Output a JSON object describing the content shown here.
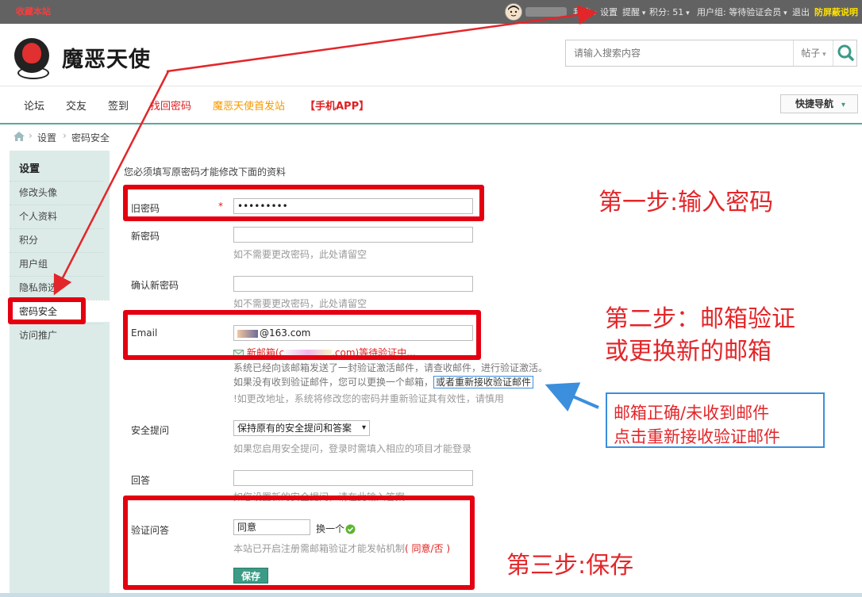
{
  "topbar": {
    "favorite": "收藏本站",
    "my": "我的",
    "settings": "设置",
    "remind": "提醒",
    "points": "积分: 51",
    "usergroup": "用户组: 等待验证会员",
    "logout": "退出",
    "anti_screen": "防屏蔽说明"
  },
  "header": {
    "logo_text": "魔恶天使",
    "search_placeholder": "请输入搜索内容",
    "search_type": "帖子"
  },
  "nav": {
    "items": [
      "论坛",
      "交友",
      "签到",
      "找回密码",
      "魔恶天使首发站",
      "【手机APP】"
    ],
    "quick_nav": "快捷导航"
  },
  "breadcrumb": {
    "items": [
      "设置",
      "密码安全"
    ]
  },
  "sidebar": {
    "title": "设置",
    "items": [
      "修改头像",
      "个人资料",
      "积分",
      "用户组",
      "隐私筛选",
      "密码安全",
      "访问推广"
    ],
    "active_index": 5
  },
  "form": {
    "intro": "您必须填写原密码才能修改下面的资料",
    "old_password_label": "旧密码",
    "old_password_value": "•••••••••",
    "new_password_label": "新密码",
    "new_password_hint": "如不需要更改密码，此处请留空",
    "confirm_password_label": "确认新密码",
    "confirm_password_hint": "如不需要更改密码，此处请留空",
    "email_label": "Email",
    "email_value": "@163.com",
    "email_pending_prefix": "新邮箱(c",
    "email_pending_suffix": ".com)等待验证中...",
    "email_note1": "系统已经向该邮箱发送了一封验证激活邮件，请查收邮件，进行验证激活。",
    "email_note2": "如果没有收到验证邮件，您可以更换一个邮箱，",
    "email_resend_link": "或者重新接收验证邮件",
    "email_note3": "!如更改地址，系统将修改您的密码并重新验证其有效性，请慎用",
    "security_q_label": "安全提问",
    "security_q_value": "保持原有的安全提问和答案",
    "security_q_hint": "如果您启用安全提问，登录时需填入相应的项目才能登录",
    "answer_label": "回答",
    "answer_hint": "如您设置新的安全提问，请在此输入答案",
    "verify_label": "验证问答",
    "verify_value": "同意",
    "verify_change": "换一个",
    "verify_hint": "本站已开启注册需邮箱验证才能发帖机制",
    "verify_hint_red": "( 同意/否 )",
    "save_button": "保存"
  },
  "annotations": {
    "step1": "第一步:输入密码",
    "step2_line1": "第二步：邮箱验证",
    "step2_line2": "或更换新的邮箱",
    "step3": "第三步:保存",
    "tip_line1": "邮箱正确/未收到邮件",
    "tip_line2": "点击重新接收验证邮件"
  },
  "colors": {
    "accent_red": "#e40010",
    "teal": "#3c9b86",
    "tip_blue": "#3b8fdc"
  }
}
